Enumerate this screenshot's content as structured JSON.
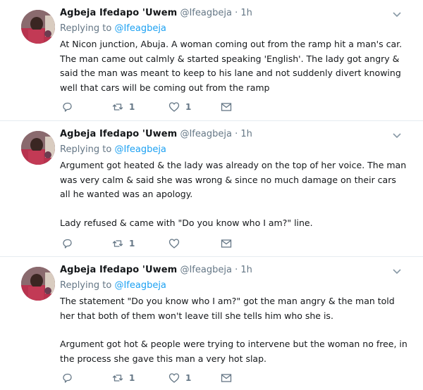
{
  "tweets": [
    {
      "author_name": "Agbeja Ifedapo 'Uwem",
      "handle": "@Ifeagbeja",
      "time": "1h",
      "replying_prefix": "Replying to",
      "replying_handle": "@Ifeagbeja",
      "paragraphs": [
        "At Nicon junction, Abuja. A woman coming out from the ramp hit a man's car. The man came out calmly & started speaking 'English'. The lady got angry & said the man was meant to keep to his lane and not suddenly divert knowing well that cars will be coming out from the ramp"
      ],
      "retweets": "1",
      "likes": "1"
    },
    {
      "author_name": "Agbeja Ifedapo 'Uwem",
      "handle": "@Ifeagbeja",
      "time": "1h",
      "replying_prefix": "Replying to",
      "replying_handle": "@Ifeagbeja",
      "paragraphs": [
        "Argument got heated & the lady was already on the top of her voice. The man was very calm & said she was wrong & since no much damage on their cars all he wanted was an apology.",
        "Lady refused & came with \"Do you know who I am?\" line."
      ],
      "retweets": "1",
      "likes": ""
    },
    {
      "author_name": "Agbeja Ifedapo 'Uwem",
      "handle": "@Ifeagbeja",
      "time": "1h",
      "replying_prefix": "Replying to",
      "replying_handle": "@Ifeagbeja",
      "paragraphs": [
        "The statement \"Do you know who I am?\" got the man angry & the man told her that both of them won't leave till she tells him who she is.",
        "Argument got hot & people were trying to intervene but the woman no free, in the process she gave this man a very hot slap."
      ],
      "retweets": "1",
      "likes": "1"
    }
  ],
  "separator": "·",
  "icons": {
    "reply": "reply-icon",
    "retweet": "retweet-icon",
    "like": "heart-icon",
    "dm": "envelope-icon",
    "menu": "chevron-down-icon"
  },
  "colors": {
    "link": "#1da1f2",
    "muted": "#657786",
    "text": "#14171a",
    "border": "#e6ecf0"
  }
}
